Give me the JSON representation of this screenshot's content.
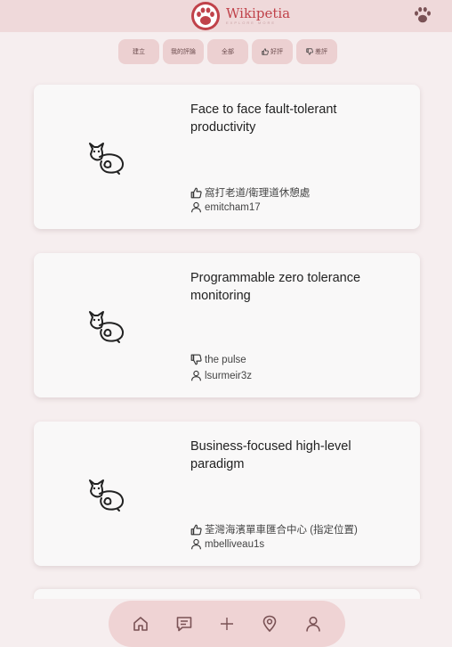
{
  "header": {
    "title": "Wikipetia",
    "tagline": "EXPLORE MORE",
    "logo_icon": "paw-icon",
    "menu_icon": "paw-icon",
    "accent": "#c0424a"
  },
  "filters": [
    {
      "label": "建立",
      "icon": ""
    },
    {
      "label": "我的評論",
      "icon": ""
    },
    {
      "label": "全部",
      "icon": ""
    },
    {
      "label": "好評",
      "icon": "thumbs-up-icon"
    },
    {
      "label": "差評",
      "icon": "thumbs-down-icon"
    }
  ],
  "cards": [
    {
      "title": "Face to face fault-tolerant productivity",
      "rating": "good",
      "place": "窩打老道/衛理道休憩處",
      "user": "emitcham17"
    },
    {
      "title": "Programmable zero tolerance monitoring",
      "rating": "bad",
      "place": "the pulse",
      "user": "lsurmeir3z"
    },
    {
      "title": "Business-focused high-level paradigm",
      "rating": "good",
      "place": "荃灣海濱單車匯合中心 (指定位置)",
      "user": "mbelliveau1s"
    }
  ],
  "bottom_nav": [
    "home-icon",
    "comment-icon",
    "plus-icon",
    "location-pin-icon",
    "user-icon"
  ]
}
